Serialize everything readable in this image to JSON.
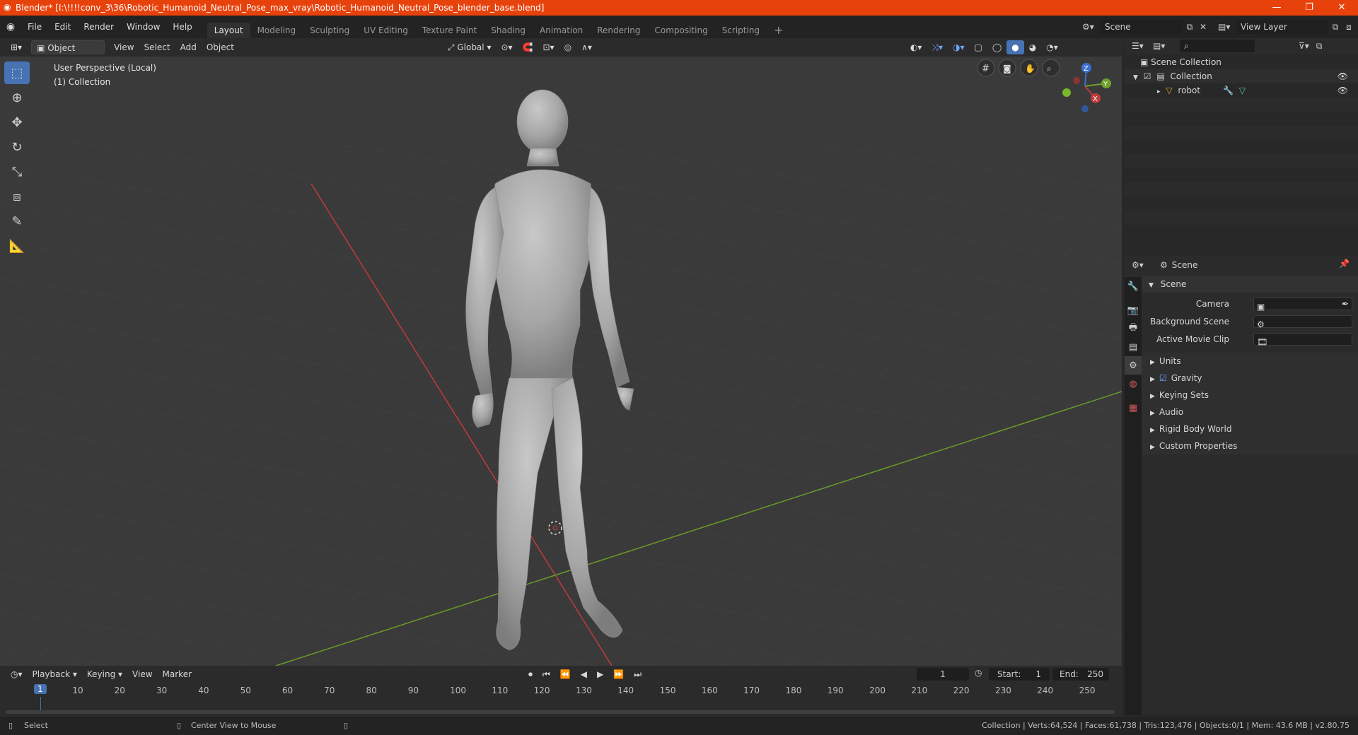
{
  "title": "Blender* [I:\\!!!!conv_3\\36\\Robotic_Humanoid_Neutral_Pose_max_vray\\Robotic_Humanoid_Neutral_Pose_blender_base.blend]",
  "menus": [
    "File",
    "Edit",
    "Render",
    "Window",
    "Help"
  ],
  "workspaces": [
    "Layout",
    "Modeling",
    "Sculpting",
    "UV Editing",
    "Texture Paint",
    "Shading",
    "Animation",
    "Rendering",
    "Compositing",
    "Scripting"
  ],
  "active_workspace": "Layout",
  "scene_name": "Scene",
  "view_layer": "View Layer",
  "viewport": {
    "mode": "Object Mode",
    "menus": [
      "View",
      "Select",
      "Add",
      "Object"
    ],
    "transform_orientation": "Global",
    "info_line1": "User Perspective (Local)",
    "info_line2": "(1) Collection",
    "gizmo": {
      "x": "X",
      "y": "Y",
      "z": "Z"
    }
  },
  "outliner": {
    "root": "Scene Collection",
    "collection": "Collection",
    "object": "robot"
  },
  "properties": {
    "context": "Scene",
    "section": "Scene",
    "camera_label": "Camera",
    "bg_scene_label": "Background Scene",
    "movie_clip_label": "Active Movie Clip",
    "panels": [
      "Units",
      "Gravity",
      "Keying Sets",
      "Audio",
      "Rigid Body World",
      "Custom Properties"
    ],
    "gravity_checked": true
  },
  "timeline": {
    "menus": [
      "Playback",
      "Keying",
      "View",
      "Marker"
    ],
    "current_frame": "1",
    "start_label": "Start:",
    "start": "1",
    "end_label": "End:",
    "end": "250",
    "ticks": [
      "10",
      "20",
      "30",
      "40",
      "50",
      "60",
      "70",
      "80",
      "90",
      "100",
      "110",
      "120",
      "130",
      "140",
      "150",
      "160",
      "170",
      "180",
      "190",
      "200",
      "210",
      "220",
      "230",
      "240",
      "250"
    ],
    "playhead": "1"
  },
  "status": {
    "left1": "Select",
    "left2": "Center View to Mouse",
    "right": "Collection | Verts:64,524 | Faces:61,738 | Tris:123,476 | Objects:0/1 | Mem: 43.6 MB | v2.80.75"
  },
  "colors": {
    "title_bar": "#e8420c",
    "accent": "#4772b3",
    "x_axis": "#c23a3a",
    "y_axis": "#6a9a2a"
  }
}
